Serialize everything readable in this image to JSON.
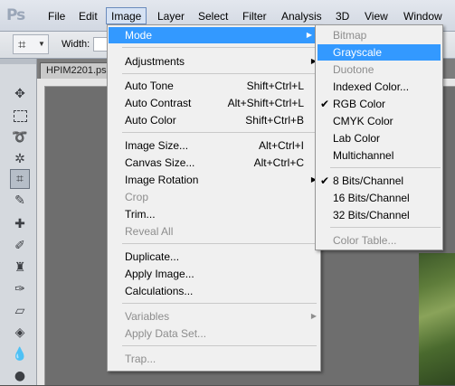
{
  "app": {
    "logo": "Ps"
  },
  "menubar": {
    "items": [
      {
        "label": "File"
      },
      {
        "label": "Edit"
      },
      {
        "label": "Image"
      },
      {
        "label": "Layer"
      },
      {
        "label": "Select"
      },
      {
        "label": "Filter"
      },
      {
        "label": "Analysis"
      },
      {
        "label": "3D"
      },
      {
        "label": "View"
      },
      {
        "label": "Window"
      }
    ]
  },
  "options": {
    "width_label": "Width:"
  },
  "document": {
    "tab_label": "HPIM2201.ps"
  },
  "image_menu": {
    "mode": "Mode",
    "adjustments": "Adjustments",
    "auto_tone": "Auto Tone",
    "auto_tone_sc": "Shift+Ctrl+L",
    "auto_contrast": "Auto Contrast",
    "auto_contrast_sc": "Alt+Shift+Ctrl+L",
    "auto_color": "Auto Color",
    "auto_color_sc": "Shift+Ctrl+B",
    "image_size": "Image Size...",
    "image_size_sc": "Alt+Ctrl+I",
    "canvas_size": "Canvas Size...",
    "canvas_size_sc": "Alt+Ctrl+C",
    "image_rotation": "Image Rotation",
    "crop": "Crop",
    "trim": "Trim...",
    "reveal_all": "Reveal All",
    "duplicate": "Duplicate...",
    "apply_image": "Apply Image...",
    "calculations": "Calculations...",
    "variables": "Variables",
    "apply_data_set": "Apply Data Set...",
    "trap": "Trap..."
  },
  "mode_menu": {
    "bitmap": "Bitmap",
    "grayscale": "Grayscale",
    "duotone": "Duotone",
    "indexed_color": "Indexed Color...",
    "rgb_color": "RGB Color",
    "cmyk_color": "CMYK Color",
    "lab_color": "Lab Color",
    "multichannel": "Multichannel",
    "bits8": "8 Bits/Channel",
    "bits16": "16 Bits/Channel",
    "bits32": "32 Bits/Channel",
    "color_table": "Color Table...",
    "checked_mode": "RGB Color",
    "checked_depth": "8 Bits/Channel",
    "highlighted": "Grayscale"
  },
  "colors": {
    "highlight": "#3399ff",
    "disabled_text": "#8d8d8d"
  }
}
